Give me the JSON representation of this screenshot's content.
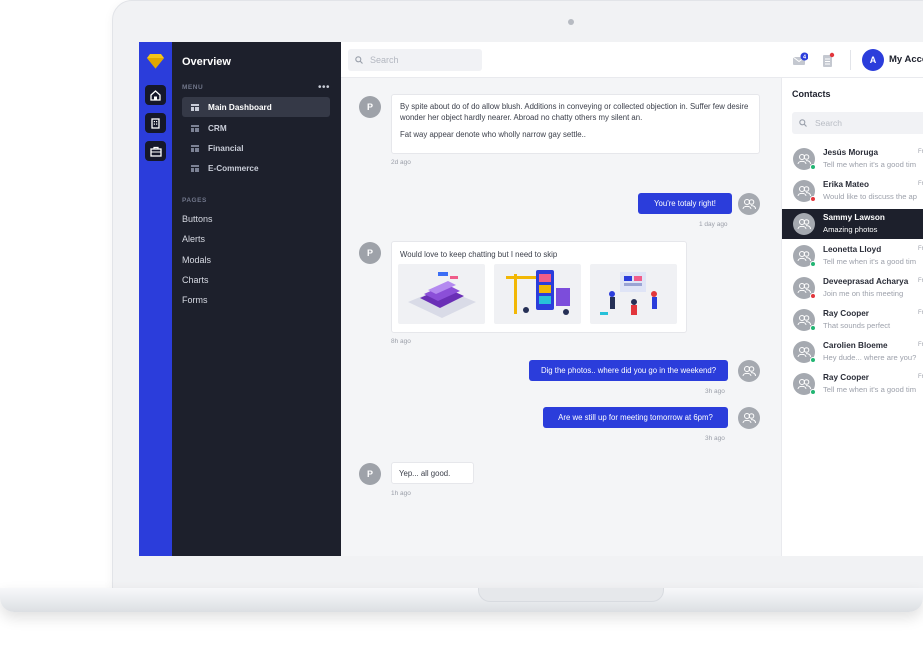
{
  "sidebar": {
    "title": "Overview",
    "menu_label": "MENU",
    "menu_more": "•••",
    "menu_items": [
      {
        "label": "Main Dashboard"
      },
      {
        "label": "CRM"
      },
      {
        "label": "Financial"
      },
      {
        "label": "E-Commerce"
      }
    ],
    "pages_label": "PAGES",
    "pages": [
      {
        "label": "Buttons"
      },
      {
        "label": "Alerts"
      },
      {
        "label": "Modals"
      },
      {
        "label": "Charts"
      },
      {
        "label": "Forms"
      }
    ]
  },
  "topbar": {
    "search_placeholder": "Search",
    "mail_badge": "4",
    "avatar_initial": "A",
    "account_label": "My Acco"
  },
  "chat": {
    "messages": [
      {
        "from": "P",
        "text_line1": "By spite about do of do allow blush. Additions in conveying or collected objection in.  Suffer few desire wonder her object hardly nearer. Abroad no chatty others my silent an.",
        "text_line2": "Fat way appear denote who wholly narrow gay settle..",
        "time": "2d ago"
      },
      {
        "from": "me",
        "text": "You're totaly right!",
        "time": "1 day ago"
      },
      {
        "from": "P",
        "text": "Would love to keep chatting but I need to skip",
        "time": "8h ago"
      },
      {
        "from": "me",
        "text": "Dig the photos.. where did you go in the weekend?",
        "time": "3h ago"
      },
      {
        "from": "me",
        "text": "Are we still up for meeting tomorrow at 6pm?",
        "time": "3h ago"
      },
      {
        "from": "P",
        "text": "Yep... all good.",
        "time": "1h ago"
      }
    ]
  },
  "contacts": {
    "title": "Contacts",
    "search_placeholder": "Search",
    "items": [
      {
        "name": "Jesús Moruga",
        "message": "Tell me when it's a good tim",
        "time": "Fr",
        "status_color": "#22b573"
      },
      {
        "name": "Erika Mateo",
        "message": "Would like to discuss the ap",
        "time": "Fr",
        "status_color": "#e2363c"
      },
      {
        "name": "Sammy Lawson",
        "message": "Amazing photos",
        "time": "Fr",
        "status_color": "#22b573"
      },
      {
        "name": "Leonetta Lloyd",
        "message": "Tell me when it's a good tim",
        "time": "Fr",
        "status_color": "#22b573"
      },
      {
        "name": "Deveeprasad Acharya",
        "message": "Join me on this meeting",
        "time": "Fr",
        "status_color": "#e2363c"
      },
      {
        "name": "Ray Cooper",
        "message": "That sounds perfect",
        "time": "Fr",
        "status_color": "#22b573"
      },
      {
        "name": "Carolien Bloeme",
        "message": "Hey dude... where are you?",
        "time": "Fr",
        "status_color": "#22b573"
      },
      {
        "name": "Ray Cooper",
        "message": "Tell me when it's a good tim",
        "time": "Fr",
        "status_color": "#22b573"
      }
    ]
  },
  "colors": {
    "accent": "#2b3ddb",
    "sidebar_bg": "#1d202c",
    "online": "#22b573",
    "busy": "#e2363c"
  }
}
